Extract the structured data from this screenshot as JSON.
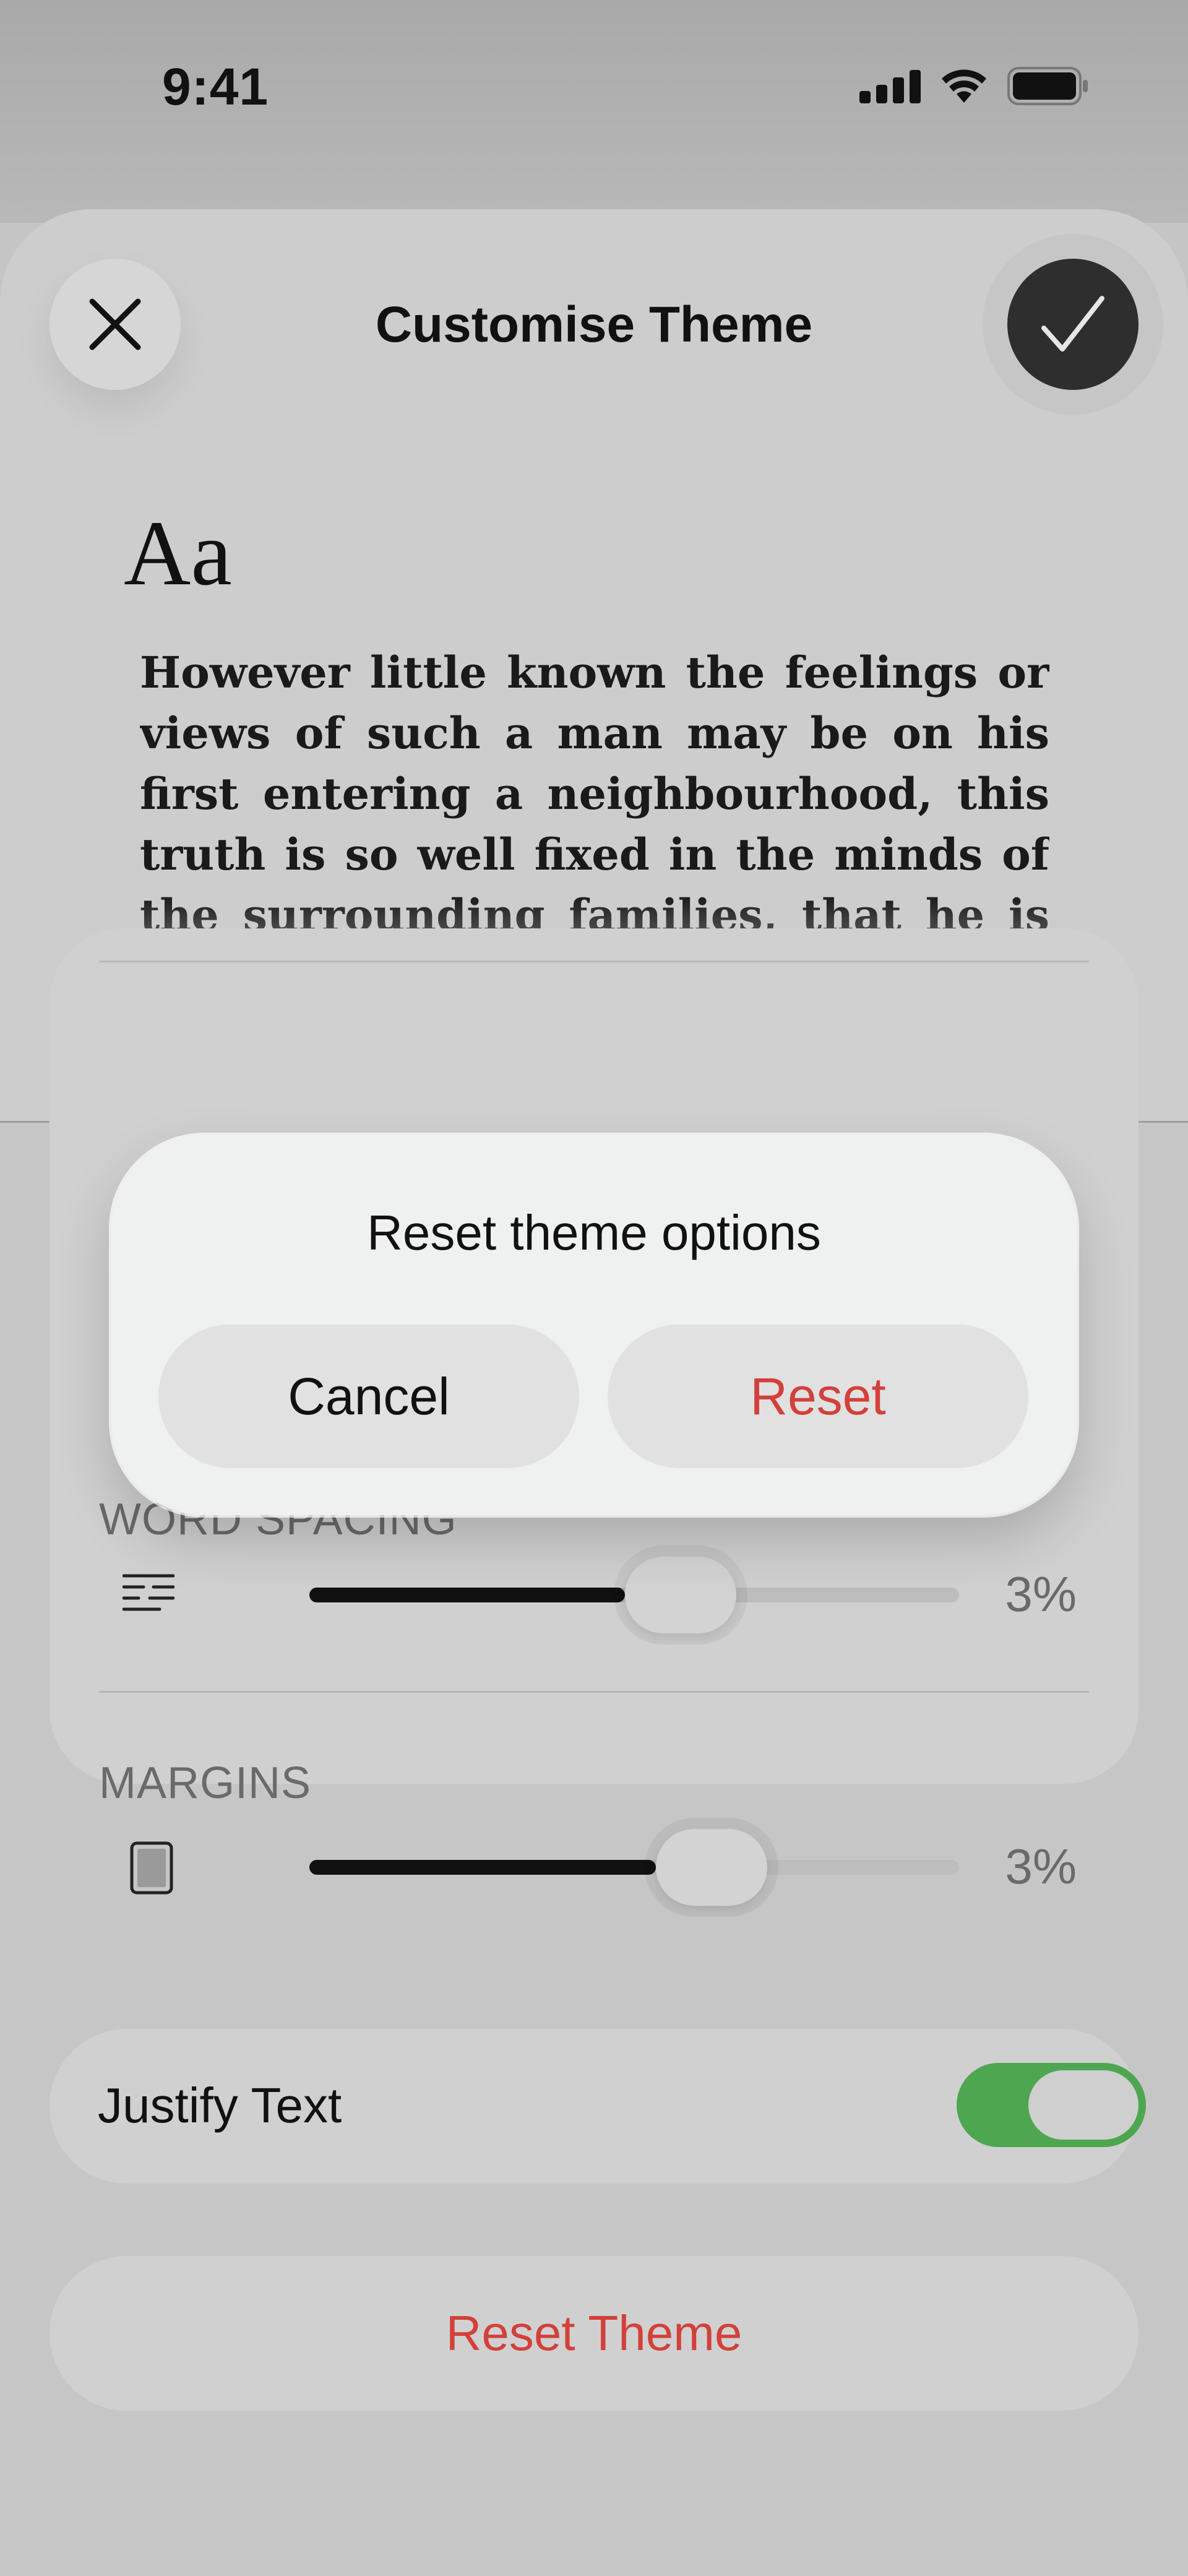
{
  "status_bar": {
    "time": "9:41",
    "icons": [
      "cellular-signal-icon",
      "wifi-icon",
      "battery-icon"
    ]
  },
  "sheet": {
    "title": "Customise Theme",
    "close_icon": "close-icon",
    "confirm_icon": "checkmark-icon"
  },
  "preview": {
    "sample_glyphs": "Aa",
    "sample_text": "However little known the feelings or views of such a man may be on his first entering a neighbourhood, this truth is so well fixed in the minds of the surrounding families, that he is considered the rightful property of some one or other of their daugh-"
  },
  "settings": {
    "word_spacing": {
      "label": "WORD SPACING",
      "value": "3%",
      "level_percent": 50,
      "icon": "word-spacing-icon"
    },
    "margins": {
      "label": "MARGINS",
      "value": "3%",
      "level_percent": 55,
      "icon": "margins-icon"
    }
  },
  "justify": {
    "label": "Justify Text",
    "enabled": true
  },
  "reset_theme": {
    "label": "Reset Theme"
  },
  "dialog": {
    "title": "Reset theme options",
    "cancel_label": "Cancel",
    "reset_label": "Reset"
  },
  "colors": {
    "accent_green": "#4ea650",
    "destructive_red": "#d3403a",
    "confirm_dark": "#2e2e2e"
  }
}
